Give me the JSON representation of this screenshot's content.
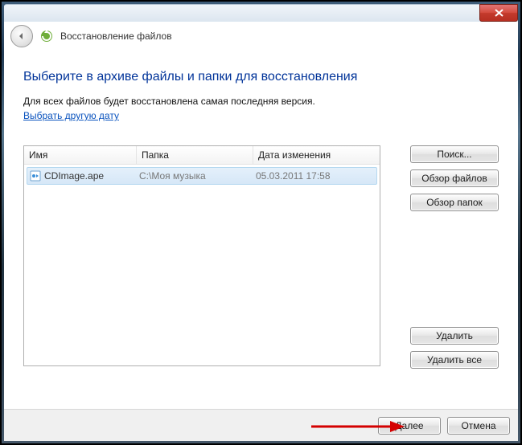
{
  "header": {
    "title": "Восстановление файлов"
  },
  "main": {
    "heading": "Выберите в архиве файлы и папки для восстановления",
    "subtext": "Для всех файлов будет восстановлена самая последняя версия.",
    "choose_date_link": "Выбрать другую дату"
  },
  "list": {
    "columns": {
      "name": "Имя",
      "folder": "Папка",
      "date": "Дата изменения"
    },
    "rows": [
      {
        "name": "CDImage.ape",
        "folder": "C:\\Моя музыка",
        "date": "05.03.2011 17:58"
      }
    ]
  },
  "sidebar": {
    "search": "Поиск...",
    "browse_files": "Обзор файлов",
    "browse_folders": "Обзор папок",
    "remove": "Удалить",
    "remove_all": "Удалить все"
  },
  "footer": {
    "next": "Далее",
    "cancel": "Отмена"
  }
}
